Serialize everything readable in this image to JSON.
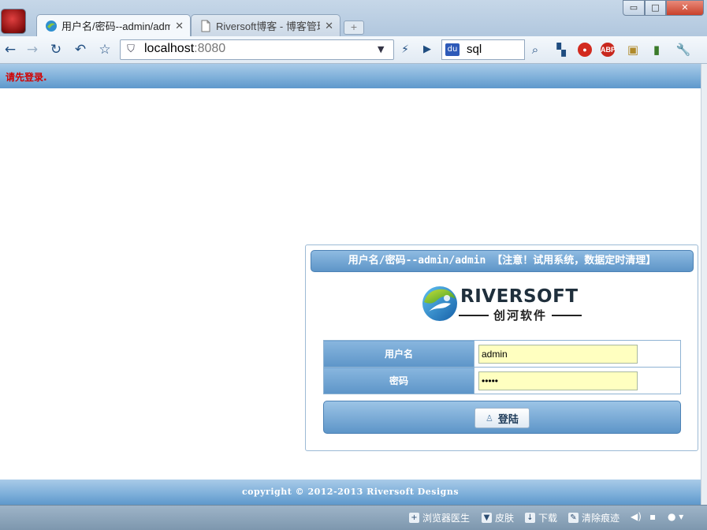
{
  "browser": {
    "tabs": [
      {
        "title": "用户名/密码--admin/admin",
        "active": true
      },
      {
        "title": "Riversoft博客 - 博客管理",
        "active": false
      }
    ],
    "window_controls": {
      "minimize": "▭",
      "maximize": "□",
      "close": "✕"
    },
    "address": {
      "host": "localhost",
      "port": ":8080"
    },
    "search": {
      "query": "sql",
      "engine_label": "du"
    },
    "extensions": [
      {
        "name": "stop-extension",
        "label": "●",
        "color": "#d22a1e"
      },
      {
        "name": "adblock-extension",
        "label": "ABP",
        "color": "#c8281e"
      }
    ]
  },
  "page": {
    "login_warning": "请先登录.",
    "panel_title": "用户名/密码--admin/admin 【注意！试用系统，数据定时清理】",
    "logo": {
      "word": "RIVERSOFT",
      "subtitle": "创河软件"
    },
    "form": {
      "username_label": "用户名",
      "username_value": "admin",
      "password_label": "密码",
      "password_value": "•••••",
      "submit_label": "登陆"
    },
    "copyright": "copyright © 2012-2013 Riversoft Designs"
  },
  "statusbar": {
    "items": [
      {
        "icon": "doctor-icon",
        "label": "浏览器医生"
      },
      {
        "icon": "shirt-icon",
        "label": "皮肤"
      },
      {
        "icon": "download-icon",
        "label": "下载"
      },
      {
        "icon": "broom-icon",
        "label": "清除痕迹"
      }
    ]
  },
  "colors": {
    "header_blue": "#7fb0da",
    "warning_red": "#d10000",
    "input_yellow": "#ffffc0"
  }
}
